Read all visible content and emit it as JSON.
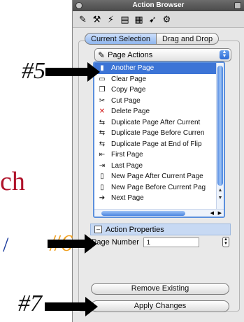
{
  "callouts": {
    "c5": "#5",
    "c6": "#6",
    "c7": "#7"
  },
  "background": {
    "fragment_ch": "ch",
    "fragment_slash": "/"
  },
  "window": {
    "title": "Action Browser"
  },
  "toolbar": {
    "icons": [
      "pencil-icon",
      "tool-icon",
      "action-icon",
      "page-icon",
      "grid-icon",
      "arrow-icon",
      "gear-icon"
    ]
  },
  "tabs": [
    {
      "label": "Current Selection",
      "active": true
    },
    {
      "label": "Drag and Drop",
      "active": false
    }
  ],
  "actions_popup": {
    "value": "Page Actions"
  },
  "action_list": [
    {
      "label": "Another Page",
      "selected": true,
      "icon": "page-icon"
    },
    {
      "label": "Clear Page",
      "selected": false,
      "icon": "eraser-icon"
    },
    {
      "label": "Copy Page",
      "selected": false,
      "icon": "copy-icon"
    },
    {
      "label": "Cut Page",
      "selected": false,
      "icon": "scissors-icon"
    },
    {
      "label": "Delete Page",
      "selected": false,
      "icon": "delete-icon"
    },
    {
      "label": "Duplicate Page After Current",
      "selected": false,
      "icon": "duplicate-icon"
    },
    {
      "label": "Duplicate Page Before Curren",
      "selected": false,
      "icon": "duplicate-icon"
    },
    {
      "label": "Duplicate Page at End of Flip",
      "selected": false,
      "icon": "duplicate-icon"
    },
    {
      "label": "First Page",
      "selected": false,
      "icon": "first-page-icon"
    },
    {
      "label": "Last Page",
      "selected": false,
      "icon": "last-page-icon"
    },
    {
      "label": "New Page After Current Page",
      "selected": false,
      "icon": "new-page-icon"
    },
    {
      "label": "New Page Before Current Pag",
      "selected": false,
      "icon": "new-page-icon"
    },
    {
      "label": "Next Page",
      "selected": false,
      "icon": "next-page-icon"
    }
  ],
  "properties": {
    "header": "Action Properties",
    "collapse_glyph": "–",
    "field_label": "Page Number",
    "field_value": "1"
  },
  "buttons": {
    "remove": "Remove Existing",
    "apply": "Apply Changes"
  },
  "colors": {
    "selection": "#3c74d6",
    "accent_tab": "#8fb6ee",
    "callout_6": "#f0a020",
    "slide_red": "#b0122a",
    "slide_blue": "#1a3a9c"
  }
}
